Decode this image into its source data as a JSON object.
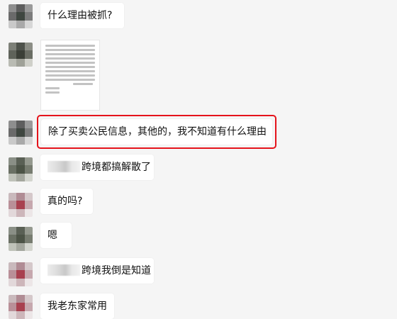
{
  "messages": [
    {
      "id": "m1",
      "type": "text",
      "text": "什么理由被抓?"
    },
    {
      "id": "m2",
      "type": "image",
      "description_icon": "document-image"
    },
    {
      "id": "m3",
      "type": "text",
      "text": "除了买卖公民信息，其他的，我不知道有什么理由",
      "highlighted": true
    },
    {
      "id": "m4",
      "type": "text",
      "redacted_prefix": true,
      "text": "跨境都搞解散了"
    },
    {
      "id": "m5",
      "type": "text",
      "text": "真的吗?"
    },
    {
      "id": "m6",
      "type": "text",
      "text": "嗯"
    },
    {
      "id": "m7",
      "type": "text",
      "redacted_prefix": true,
      "text": "跨境我倒是知道"
    },
    {
      "id": "m8",
      "type": "text",
      "text": "我老东家常用"
    }
  ],
  "colors": {
    "background": "#f5f5f5",
    "bubble": "#ffffff",
    "highlight_border": "#e5131b",
    "text": "#111111"
  }
}
